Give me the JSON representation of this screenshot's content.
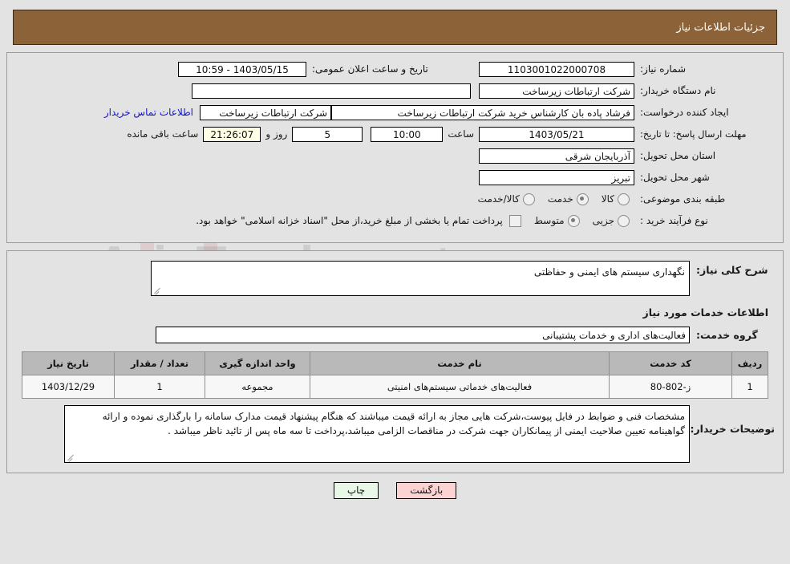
{
  "watermark": {
    "text": "AriaTender.net"
  },
  "header": {
    "title": "جزئیات اطلاعات نیاز"
  },
  "need_info": {
    "need_number_label": "شماره نیاز:",
    "need_number_value": "1103001022000708",
    "announce_datetime_label": "تاریخ و ساعت اعلان عمومی:",
    "announce_datetime_value": "1403/05/15 - 10:59",
    "buyer_org_label": "نام دستگاه خریدار:",
    "buyer_org_value": "شرکت ارتباطات زیرساخت",
    "creator_label": "ایجاد کننده درخواست:",
    "creator_value": "فرشاد پاده بان کارشناس خرید شرکت ارتباطات زیرساخت",
    "buyer_org_secondary_value": "شرکت ارتباطات زیرساخت",
    "contact_link": "اطلاعات تماس خریدار",
    "deadline_label": "مهلت ارسال پاسخ: تا تاریخ:",
    "deadline_date": "1403/05/21",
    "deadline_hour_label": "ساعت",
    "deadline_hour": "10:00",
    "remaining_days": "5",
    "remaining_days_label": "روز و",
    "remaining_time": "21:26:07",
    "remaining_time_label": "ساعت باقی مانده",
    "province_label": "استان محل تحویل:",
    "province_value": "آذربایجان شرقی",
    "city_label": "شهر محل تحویل:",
    "city_value": "تبریز",
    "category_label": "طبقه بندی موضوعی:",
    "category_options": [
      {
        "label": "کالا",
        "selected": false
      },
      {
        "label": "خدمت",
        "selected": true
      },
      {
        "label": "کالا/خدمت",
        "selected": false
      }
    ],
    "process_label": "نوع فرآیند خرید :",
    "process_options": [
      {
        "label": "جزیی",
        "selected": false
      },
      {
        "label": "متوسط",
        "selected": true
      }
    ],
    "treasury_checkbox_checked": false,
    "treasury_note": "پرداخت تمام یا بخشی از مبلغ خرید،از محل \"اسناد خزانه اسلامی\" خواهد بود."
  },
  "details": {
    "general_desc_label": "شرح کلی نیاز:",
    "general_desc_value": "نگهداری سیستم های ایمنی و حفاظتی",
    "services_section_title": "اطلاعات خدمات مورد نیاز",
    "service_group_label": "گروه خدمت:",
    "service_group_value": "فعالیت‌های اداری و خدمات پشتیبانی",
    "table": {
      "headers": [
        "ردیف",
        "کد خدمت",
        "نام خدمت",
        "واحد اندازه گیری",
        "تعداد / مقدار",
        "تاریخ نیاز"
      ],
      "rows": [
        [
          "1",
          "ز-802-80",
          "فعالیت‌های خدماتی سیستم‌های امنیتی",
          "مجموعه",
          "1",
          "1403/12/29"
        ]
      ]
    },
    "buyer_notes_label": "توضیحات خریدار:",
    "buyer_notes_value": "مشخصات فنی و ضوابط در فایل پیوست،شرکت هایی مجاز به ارائه قیمت میباشند که هنگام پیشنهاد قیمت مدارک سامانه را بارگذاری نموده و ارائه گواهینامه تعیین صلاحیت ایمنی از پیمانکاران جهت شرکت در مناقصات الزامی میباشد،پرداخت تا سه ماه پس از تائید ناظر میباشد ."
  },
  "buttons": {
    "print": "چاپ",
    "back": "بازگشت"
  }
}
